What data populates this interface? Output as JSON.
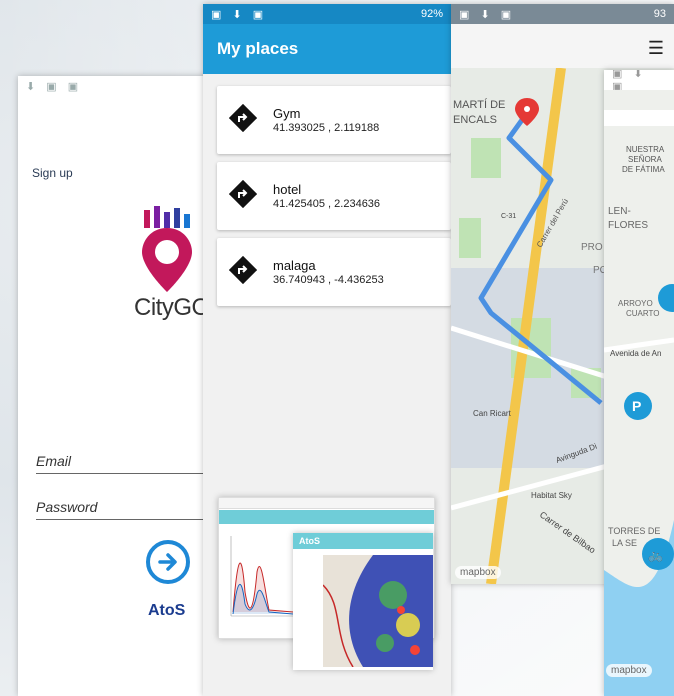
{
  "login": {
    "signup_label": "Sign up",
    "logo_text": "CityGO",
    "email_label": "Email",
    "password_label": "Password",
    "brand_label": "AtoS"
  },
  "places": {
    "status_right": "92%",
    "title": "My places",
    "items": [
      {
        "name": "Gym",
        "coords": "41.393025 , 2.119188"
      },
      {
        "name": "hotel",
        "coords": "41.425405 , 2.234636"
      },
      {
        "name": "malaga",
        "coords": "36.740943 , -4.436253"
      }
    ]
  },
  "dashboard": {
    "header_label": "AtoS"
  },
  "map": {
    "status_right": "93",
    "labels": {
      "marti": "MARTÍ DE",
      "encals": "ENCALS",
      "carrer_peru": "Carrer del Perú",
      "road": "C-31",
      "pro": "PRO",
      "po": "PO",
      "can_ricart": "Can Ricart",
      "habitat_sky": "Habitat Sky",
      "avinguda": "Avinguda Di",
      "carrer_bilbao": "Carrer de Bilbao",
      "mapbox": "mapbox"
    }
  },
  "map2": {
    "labels": {
      "nuestra": "NUESTRA",
      "senora": "SEÑORA",
      "fatima": "DE FÁTIMA",
      "len": "LEN-",
      "flores": "FLORES",
      "arroyo": "ARROYO",
      "cuarto": "CUARTO",
      "avenida": "Avenida de An",
      "torres": "TORRES DE",
      "lase": "LA SE",
      "mapbox": "mapbox"
    }
  },
  "colors": {
    "primary": "#1e9bd7",
    "route": "#4a90e2",
    "brand_blue": "#1b3c8f",
    "logo_pink": "#c2185b"
  }
}
